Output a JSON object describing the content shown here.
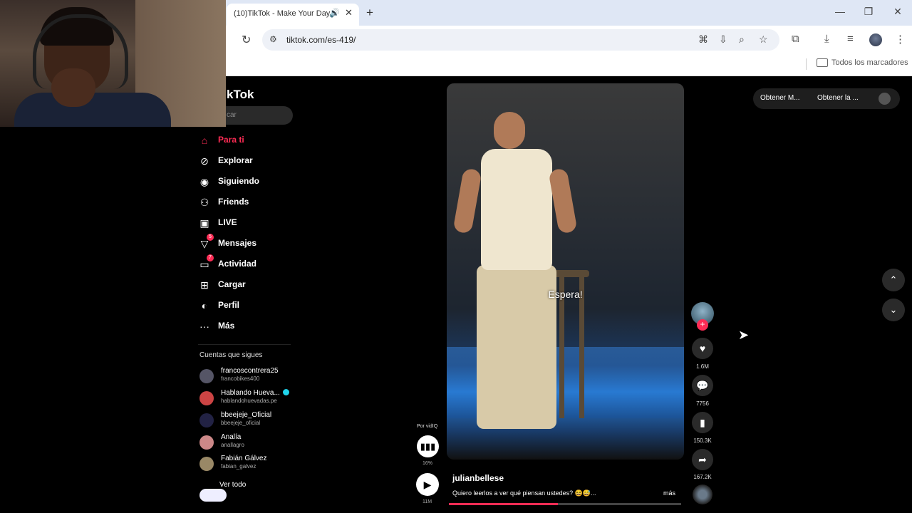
{
  "browser": {
    "tab_title": "(10)TikTok - Make Your Day",
    "url": "tiktok.com/es-419/",
    "bookmarks_label": "Todos los marcadores"
  },
  "tiktok": {
    "logo": "kTok",
    "search_placeholder": "car",
    "nav": [
      {
        "label": "Para ti",
        "icon": "home-icon",
        "glyph": "⌂"
      },
      {
        "label": "Explorar",
        "icon": "compass-icon",
        "glyph": "⊘"
      },
      {
        "label": "Siguiendo",
        "icon": "following-icon",
        "glyph": "◉"
      },
      {
        "label": "Friends",
        "icon": "friends-icon",
        "glyph": "⚇"
      },
      {
        "label": "LIVE",
        "icon": "live-icon",
        "glyph": "▣"
      },
      {
        "label": "Mensajes",
        "icon": "messages-icon",
        "glyph": "▽",
        "badge": "5"
      },
      {
        "label": "Actividad",
        "icon": "activity-icon",
        "glyph": "▭",
        "badge": "7"
      },
      {
        "label": "Cargar",
        "icon": "upload-icon",
        "glyph": "⊞"
      },
      {
        "label": "Perfil",
        "icon": "profile-icon",
        "glyph": "◐"
      },
      {
        "label": "Más",
        "icon": "more-icon",
        "glyph": "···"
      }
    ],
    "following_header": "Cuentas que sigues",
    "accounts": [
      {
        "name": "francoscontrera25",
        "user": "francobikes400",
        "color": "#556"
      },
      {
        "name": "Hablando Hueva...",
        "user": "hablandohuevadas.pe",
        "color": "#c44",
        "verified": true
      },
      {
        "name": "bbeejeje_Oficial",
        "user": "bbeejeje_oficial",
        "color": "#224"
      },
      {
        "name": "Analía",
        "user": "anallagro",
        "color": "#c88"
      },
      {
        "name": "Fabián Gálvez",
        "user": "fabian_galvez",
        "color": "#986"
      }
    ],
    "see_all": "Ver todo",
    "top_actions": [
      "Obtener M...",
      "Obtener la ..."
    ]
  },
  "video": {
    "caption": "Espera!",
    "author": "julianbellese",
    "description": "Quiero leerlos a ver qué piensan ustedes? 😆😅...",
    "more": "más",
    "progress": 0.47,
    "stats_label": "Por vidIQ",
    "percent": "16%",
    "duration": "11M",
    "likes": "1.6M",
    "comments": "7756",
    "saves": "150.3K",
    "shares": "167.2K"
  }
}
